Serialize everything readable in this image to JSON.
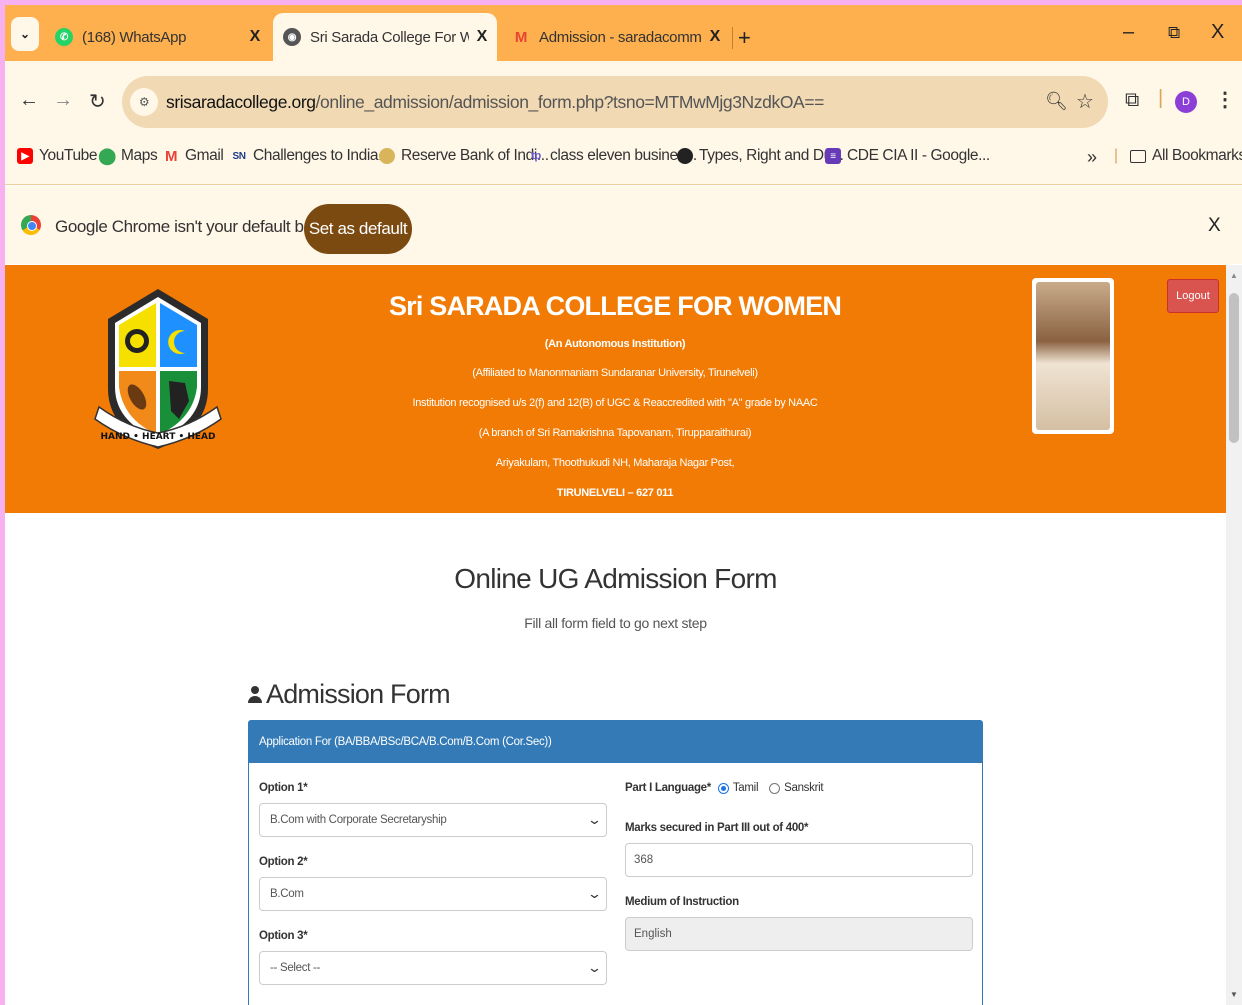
{
  "browser": {
    "tabs": [
      {
        "title": "(168) WhatsApp",
        "icon": "whatsapp-icon"
      },
      {
        "title": "Sri Sarada College For Women -",
        "icon": "globe-icon",
        "active": true
      },
      {
        "title": "Admission - saradacommerceca",
        "icon": "gmail-icon"
      }
    ],
    "tab_close": "X",
    "new_tab": "+",
    "window": {
      "minimize": "–",
      "restore": "⧉",
      "close": "X"
    },
    "url_domain": "srisaradacollege.org",
    "url_path": "/online_admission/admission_form.php?tsno=MTMwMjg3NzdkOA==",
    "profile_initial": "D",
    "bookmarks": [
      {
        "label": "YouTube",
        "icon": "youtube-icon",
        "color": "#ff0000"
      },
      {
        "label": "Maps",
        "icon": "maps-icon",
        "color": "#34a853"
      },
      {
        "label": "Gmail",
        "icon": "gmail-icon",
        "color": "#ea4335"
      },
      {
        "label": "Challenges to India...",
        "icon": "sn-icon",
        "color": "#1e3a8a",
        "glyph": "SN"
      },
      {
        "label": "Reserve Bank of Indi...",
        "icon": "rbi-icon",
        "color": "#b8912a"
      },
      {
        "label": "class eleven busines...",
        "icon": "toppr-icon",
        "color": "#6a5acd"
      },
      {
        "label": "Types, Right and Du...",
        "icon": "globe-icon",
        "color": "#222222"
      },
      {
        "label": "CDE CIA II - Google...",
        "icon": "google-forms-icon",
        "color": "#673ab7"
      }
    ],
    "bookmarks_overflow": "»",
    "all_bookmarks": "All Bookmarks",
    "infobar_text": "Google Chrome isn't your default browser",
    "infobar_button": "Set as default",
    "infobar_close": "X"
  },
  "header": {
    "title": "Sri SARADA COLLEGE FOR WOMEN",
    "lines": [
      "(An Autonomous Institution)",
      "(Affiliated to Manonmaniam Sundaranar University, Tirunelveli)",
      "Institution recognised u/s 2(f) and 12(B) of UGC & Reaccredited with \"A\" grade by NAAC",
      "(A branch of Sri Ramakrishna Tapovanam, Tirupparaithurai)",
      "Ariyakulam, Thoothukudi NH, Maharaja Nagar Post,",
      "TIRUNELVELI – 627 011"
    ],
    "crest_motto": "HAND • HEART • HEAD",
    "logout": "Logout"
  },
  "form": {
    "title": "Online UG Admission Form",
    "subtitle": "Fill all form field to go next step",
    "section_title": "Admission Form",
    "panel_heading": "Application For (BA/BBA/BSc/BCA/B.Com/B.Com (Cor.Sec))",
    "option1_label": "Option 1*",
    "option1_value": "B.Com with Corporate Secretaryship",
    "option2_label": "Option 2*",
    "option2_value": "B.Com",
    "option3_label": "Option 3*",
    "option3_value": "-- Select --",
    "language_label": "Part I Language*",
    "language_options": [
      "Tamil",
      "Sanskrit"
    ],
    "language_selected": "Tamil",
    "marks_label": "Marks secured in Part III out of 400*",
    "marks_value": "368",
    "medium_label": "Medium of Instruction",
    "medium_value": "English"
  },
  "colors": {
    "tabstrip": "#fdb04d",
    "toolbar": "#fff7e8",
    "header": "#f27b05",
    "panel": "#337ab7",
    "logout": "#d9534f"
  }
}
